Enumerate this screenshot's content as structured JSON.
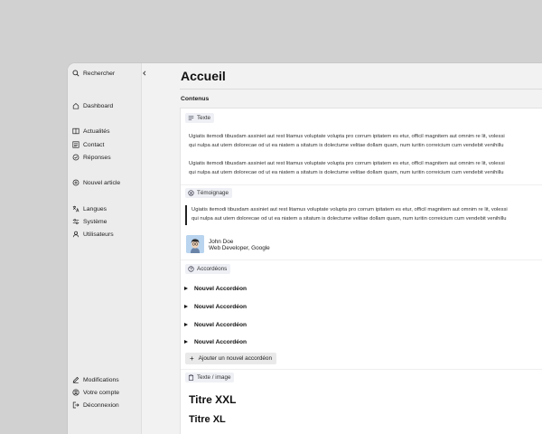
{
  "sidebar": {
    "search_label": "Rechercher",
    "items": [
      {
        "label": "Dashboard",
        "icon": "home-icon"
      },
      {
        "label": "Actualités",
        "icon": "book-icon"
      },
      {
        "label": "Contact",
        "icon": "list-icon"
      },
      {
        "label": "Réponses",
        "icon": "check-circle-icon"
      },
      {
        "label": "Nouvel article",
        "icon": "plus-circle-icon"
      },
      {
        "label": "Langues",
        "icon": "translate-icon"
      },
      {
        "label": "Système",
        "icon": "sliders-icon"
      },
      {
        "label": "Utilisateurs",
        "icon": "user-icon"
      }
    ],
    "bottom_items": [
      {
        "label": "Modifications",
        "icon": "pencil-icon"
      },
      {
        "label": "Votre compte",
        "icon": "account-icon"
      },
      {
        "label": "Déconnexion",
        "icon": "logout-icon"
      }
    ]
  },
  "main": {
    "title": "Accueil",
    "section_label": "Contenus"
  },
  "blocks": {
    "text": {
      "chip": "Texte",
      "para1_line1": "Ugiatis itemodi tibusdam assiniet aut rest litamus voluptate volupta pro corrum ipitatem es etur, officil magnitem aut omnim re lit, volessi",
      "para1_line2": "qui nulpa aut utem dolorecae od ut ea niatem a sitatum is dolectume velitae dollam quam, num iuritin correicium cum vendebit venihillu",
      "para2_line1": "Ugiatis itemodi tibusdam assiniet aut rest litamus voluptate volupta pro corrum ipitatem es etur, officil magnitem aut omnim re lit, volessi",
      "para2_line2": "qui nulpa aut utem dolorecae od ut ea niatem a sitatum is dolectume velitae dollam quam, num iuritin correicium cum vendebit venihillu"
    },
    "testimonial": {
      "chip": "Témoignage",
      "quote_line1": "Ugiatis itemodi tibusdam assiniet aut rest litamus voluptate volupta pro corrum ipitatem es etur, officil magnitem aut omnim re lit, volessi",
      "quote_line2": "qui nulpa aut utem dolorecae od ut ea niatem a sitatum is dolectume velitae dollam quam, num iuritin correicium cum vendebit venihillu",
      "author_name": "John Doe",
      "author_role": "Web Developer, Google"
    },
    "accordions": {
      "chip": "Accordéons",
      "items": [
        "Nouvel Accordéon",
        "Nouvel Accordéon",
        "Nouvel Accordéon",
        "Nouvel Accordéon"
      ],
      "add_label": "Ajouter un nouvel accordéon"
    },
    "text_image": {
      "chip": "Texte / image",
      "title_xxl": "Titre XXL",
      "title_xl": "Titre XL"
    }
  }
}
